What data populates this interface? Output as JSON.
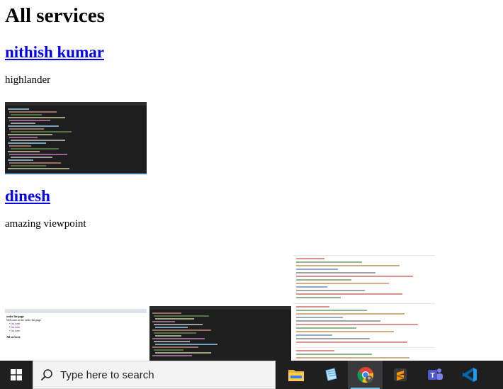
{
  "page": {
    "title": "All services"
  },
  "services": [
    {
      "name": "nithish kumar",
      "description": "highlander"
    },
    {
      "name": "dinesh",
      "description": "amazing viewpoint"
    }
  ],
  "thumbnails": {
    "web": {
      "heading": "order list page",
      "intro": "Welcome to the order list page",
      "links": [
        "• list item",
        "• list item",
        "• list item"
      ],
      "footer": "All services"
    }
  },
  "taskbar": {
    "search_placeholder": "Type here to search",
    "apps": [
      "file-explorer",
      "notepad",
      "chrome",
      "sublime-text",
      "teams",
      "vscode"
    ],
    "active_app": "chrome",
    "accent": "#76b9ed"
  }
}
